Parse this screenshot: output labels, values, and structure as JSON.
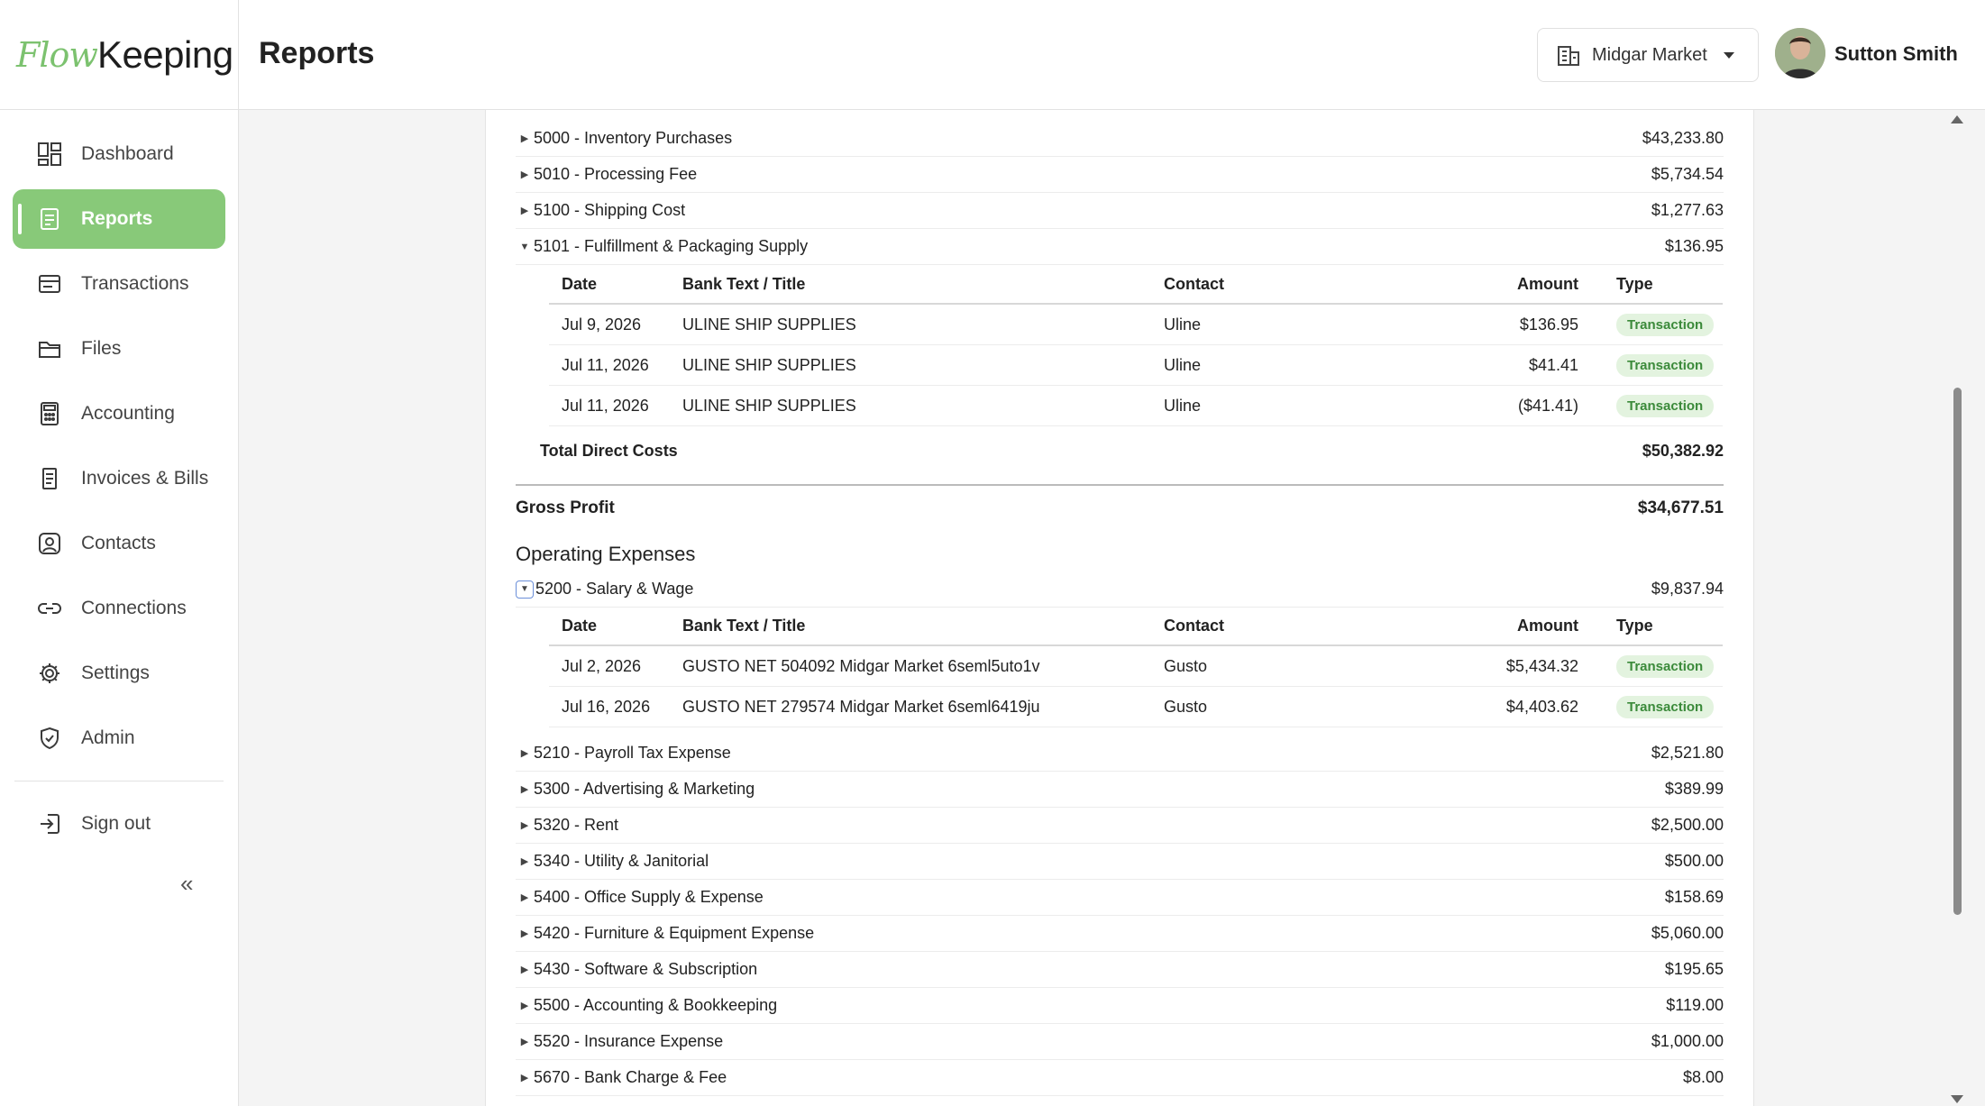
{
  "brand": {
    "logo_flow": "Flow",
    "logo_keeping": "Keeping",
    "accent": "#88c979"
  },
  "header": {
    "title": "Reports",
    "company": "Midgar Market",
    "user": "Sutton Smith"
  },
  "sidebar": {
    "items": [
      {
        "label": "Dashboard",
        "icon": "dashboard-icon"
      },
      {
        "label": "Reports",
        "icon": "reports-icon",
        "active": true
      },
      {
        "label": "Transactions",
        "icon": "transactions-icon"
      },
      {
        "label": "Files",
        "icon": "folder-icon"
      },
      {
        "label": "Accounting",
        "icon": "calculator-icon"
      },
      {
        "label": "Invoices & Bills",
        "icon": "invoice-icon"
      },
      {
        "label": "Contacts",
        "icon": "contact-icon"
      },
      {
        "label": "Connections",
        "icon": "link-icon"
      },
      {
        "label": "Settings",
        "icon": "gear-icon"
      },
      {
        "label": "Admin",
        "icon": "shield-icon"
      }
    ],
    "sign_out": "Sign out",
    "collapse": "«"
  },
  "report": {
    "direct_costs": [
      {
        "label": "5000 - Inventory Purchases",
        "amount": "$43,233.80"
      },
      {
        "label": "5010 - Processing Fee",
        "amount": "$5,734.54"
      },
      {
        "label": "5100 - Shipping Cost",
        "amount": "$1,277.63"
      },
      {
        "label": "5101 - Fulfillment & Packaging Supply",
        "amount": "$136.95"
      }
    ],
    "columns": {
      "date": "Date",
      "bank": "Bank Text / Title",
      "contact": "Contact",
      "amount": "Amount",
      "type": "Type"
    },
    "fulfillment_rows": [
      {
        "date": "Jul 9, 2026",
        "bank": "ULINE SHIP SUPPLIES",
        "contact": "Uline",
        "amount": "$136.95",
        "type": "Transaction"
      },
      {
        "date": "Jul 11, 2026",
        "bank": "ULINE SHIP SUPPLIES",
        "contact": "Uline",
        "amount": "$41.41",
        "type": "Transaction"
      },
      {
        "date": "Jul 11, 2026",
        "bank": "ULINE SHIP SUPPLIES",
        "contact": "Uline",
        "amount": "($41.41)",
        "type": "Transaction"
      }
    ],
    "total_direct_costs": {
      "label": "Total Direct Costs",
      "amount": "$50,382.92"
    },
    "gross_profit": {
      "label": "Gross Profit",
      "amount": "$34,677.51"
    },
    "operating_title": "Operating Expenses",
    "salary": {
      "label": "5200 - Salary & Wage",
      "amount": "$9,837.94"
    },
    "salary_rows": [
      {
        "date": "Jul 2, 2026",
        "bank": "GUSTO NET 504092 Midgar Market 6seml5uto1v",
        "contact": "Gusto",
        "amount": "$5,434.32",
        "type": "Transaction"
      },
      {
        "date": "Jul 16, 2026",
        "bank": "GUSTO NET 279574 Midgar Market 6seml6419ju",
        "contact": "Gusto",
        "amount": "$4,403.62",
        "type": "Transaction"
      }
    ],
    "operating": [
      {
        "label": "5210 - Payroll Tax Expense",
        "amount": "$2,521.80"
      },
      {
        "label": "5300 - Advertising & Marketing",
        "amount": "$389.99"
      },
      {
        "label": "5320 - Rent",
        "amount": "$2,500.00"
      },
      {
        "label": "5340 - Utility & Janitorial",
        "amount": "$500.00"
      },
      {
        "label": "5400 - Office Supply & Expense",
        "amount": "$158.69"
      },
      {
        "label": "5420 - Furniture & Equipment Expense",
        "amount": "$5,060.00"
      },
      {
        "label": "5430 - Software & Subscription",
        "amount": "$195.65"
      },
      {
        "label": "5500 - Accounting & Bookkeeping",
        "amount": "$119.00"
      },
      {
        "label": "5520 - Insurance Expense",
        "amount": "$1,000.00"
      },
      {
        "label": "5670 - Bank Charge & Fee",
        "amount": "$8.00"
      }
    ]
  }
}
